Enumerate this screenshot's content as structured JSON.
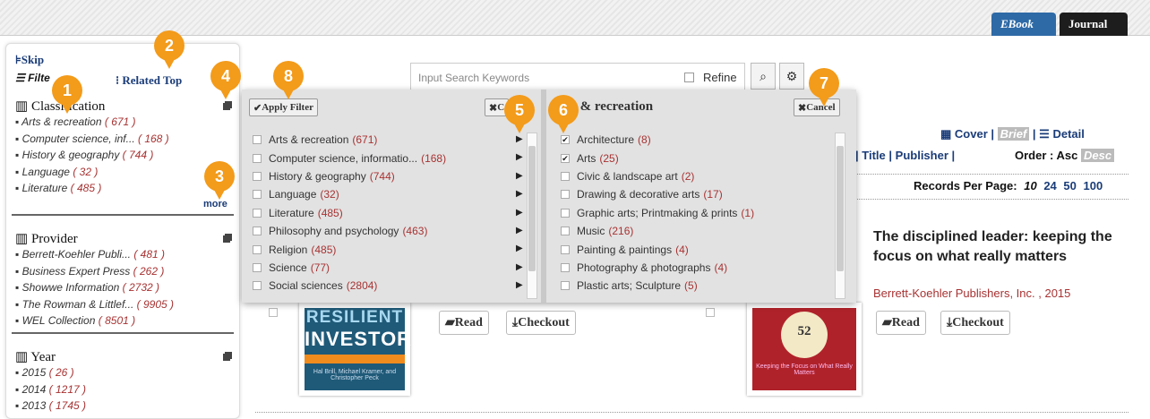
{
  "top_tabs": {
    "ebook": "EBook",
    "journal": "Journal"
  },
  "sidebar": {
    "skip": "Skip",
    "filter": "Filte",
    "related": "Related Top",
    "more": "more",
    "facets": [
      {
        "title": "Classification",
        "items": [
          {
            "label": "Arts & recreation",
            "count": "( 671 )"
          },
          {
            "label": "Computer science, inf...",
            "count": "( 168 )"
          },
          {
            "label": "History & geography",
            "count": "( 744 )"
          },
          {
            "label": "Language",
            "count": "( 32 )"
          },
          {
            "label": "Literature",
            "count": "( 485 )"
          }
        ]
      },
      {
        "title": "Provider",
        "items": [
          {
            "label": "Berrett-Koehler Publi...",
            "count": "( 481 )"
          },
          {
            "label": "Business Expert Press",
            "count": "( 262 )"
          },
          {
            "label": "Showwe Information",
            "count": "( 2732 )"
          },
          {
            "label": "The Rowman & Littlef...",
            "count": "( 9905 )"
          },
          {
            "label": "WEL Collection",
            "count": "( 8501 )"
          }
        ]
      },
      {
        "title": "Year",
        "items": [
          {
            "label": "2015",
            "count": "( 26 )"
          },
          {
            "label": "2014",
            "count": "( 1217 )"
          },
          {
            "label": "2013",
            "count": "( 1745 )"
          }
        ]
      }
    ]
  },
  "search": {
    "placeholder": "Input Search Keywords",
    "refine": "Refine",
    "search_icon": "search-icon",
    "settings_icon": "gear-icon"
  },
  "panel": {
    "apply": "Apply Filter",
    "cancel_left": "C",
    "right_title": "s & recreation",
    "cancel_right": "Cancel",
    "left_items": [
      {
        "label": "Arts & recreation",
        "count": "(671)"
      },
      {
        "label": "Computer science, informatio...",
        "count": "(168)"
      },
      {
        "label": "History & geography",
        "count": "(744)"
      },
      {
        "label": "Language",
        "count": "(32)"
      },
      {
        "label": "Literature",
        "count": "(485)"
      },
      {
        "label": "Philosophy and psychology",
        "count": "(463)"
      },
      {
        "label": "Religion",
        "count": "(485)"
      },
      {
        "label": "Science",
        "count": "(77)"
      },
      {
        "label": "Social sciences",
        "count": "(2804)"
      }
    ],
    "right_items": [
      {
        "label": "Architecture",
        "count": "(8)",
        "checked": true
      },
      {
        "label": "Arts",
        "count": "(25)",
        "checked": true
      },
      {
        "label": "Civic & landscape art",
        "count": "(2)",
        "checked": false
      },
      {
        "label": "Drawing & decorative arts",
        "count": "(17)",
        "checked": false
      },
      {
        "label": "Graphic arts; Printmaking & prints",
        "count": "(1)",
        "checked": false
      },
      {
        "label": "Music",
        "count": "(216)",
        "checked": false
      },
      {
        "label": "Painting & paintings",
        "count": "(4)",
        "checked": false
      },
      {
        "label": "Photography & photographs",
        "count": "(4)",
        "checked": false
      },
      {
        "label": "Plastic arts; Sculpture",
        "count": "(5)",
        "checked": false
      }
    ]
  },
  "badges": [
    "1",
    "2",
    "3",
    "4",
    "5",
    "6",
    "7",
    "8"
  ],
  "view": {
    "cover": "Cover",
    "brief": "Brief",
    "detail": "Detail",
    "sep": "|"
  },
  "sort": {
    "title": "Title",
    "publisher": "Publisher",
    "order_label": "Order :",
    "asc": "Asc",
    "desc": "Desc"
  },
  "records": {
    "label": "Records Per Page:",
    "current": "10",
    "options": [
      "24",
      "50",
      "100"
    ]
  },
  "results": [
    {
      "cover_line1": "RESILIENT",
      "cover_line2": "INVESTOR",
      "cover_authors": "Hal Brill, Michael Kramer, and Christopher Peck",
      "read": "Read",
      "checkout": "Checkout"
    },
    {
      "title": "The disciplined leader: keeping the focus on what really matters",
      "publisher": "Berrett-Koehler Publishers, Inc. , 2015",
      "cover_number": "52",
      "cover_sub": "Keeping the Focus on What Really Matters",
      "read": "Read",
      "checkout": "Checkout"
    }
  ]
}
